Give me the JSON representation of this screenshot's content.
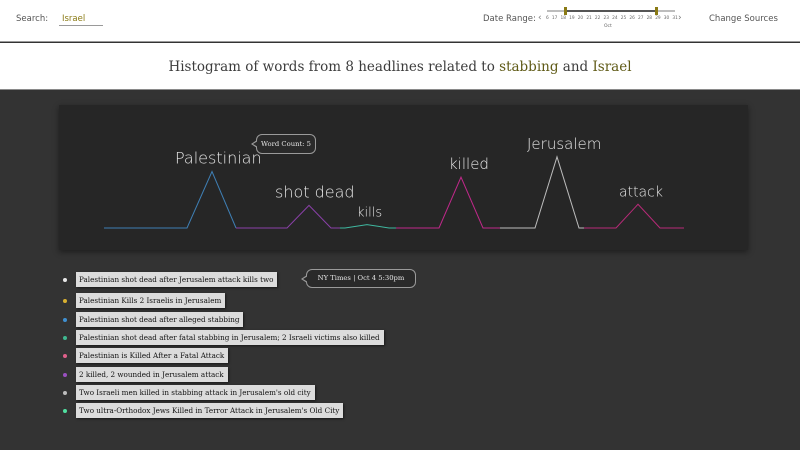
{
  "search": {
    "label": "Search:",
    "value": "Israel"
  },
  "date_range": {
    "label": "Date Range:",
    "prev_arrow": "‹",
    "next_arrow": "›",
    "days": [
      "6",
      "17",
      "18",
      "19",
      "20",
      "21",
      "22",
      "23",
      "24",
      "25",
      "26",
      "27",
      "28",
      "29",
      "30",
      "31"
    ],
    "selected_start": "18",
    "selected_end": "29",
    "month": "Oct"
  },
  "change_sources": "Change Sources",
  "title": {
    "prefix": "Histogram of words from 8 headlines related to",
    "keyword1": "stabbing",
    "conjunction": "and",
    "keyword2": "Israel",
    "keyword_color": "#5f5a16"
  },
  "chart_data": {
    "type": "line",
    "series": [
      {
        "name": "Palestinian",
        "color": "#3f7fb4",
        "peak": 5,
        "word": "Palestinian"
      },
      {
        "name": "shot dead",
        "color": "#8a40a8",
        "peak": 2,
        "word": "shot dead"
      },
      {
        "name": "kills",
        "color": "#3fb8a0",
        "peak": 0.3,
        "word": "kills"
      },
      {
        "name": "killed",
        "color": "#c0288a",
        "peak": 4.5,
        "word": "killed"
      },
      {
        "name": "Jerusalem",
        "color": "#bdbdbd",
        "peak": 6.3,
        "word": "Jerusalem"
      },
      {
        "name": "attack",
        "color": "#b82a78",
        "peak": 2.1,
        "word": "attack"
      }
    ],
    "ylim": [
      0,
      7
    ],
    "tooltip": "Word Count: 5"
  },
  "headlines": [
    {
      "text": "Palestinian shot dead after Jerusalem attack kills two",
      "dot_color": "#e8e8e8"
    },
    {
      "text": "Palestinian Kills 2 Israelis in Jerusalem",
      "dot_color": "#d8b030"
    },
    {
      "text": "Palestinian shot dead after alleged stabbing",
      "dot_color": "#3f8fd0"
    },
    {
      "text": "Palestinian shot dead after fatal stabbing in Jerusalem; 2 Israeli victims also killed",
      "dot_color": "#3fb890"
    },
    {
      "text": "Palestinian is Killed After a Fatal Attack",
      "dot_color": "#e0608a"
    },
    {
      "text": "2 killed, 2 wounded in Jerusalem attack",
      "dot_color": "#9a50c0"
    },
    {
      "text": "Two Israeli men killed in stabbing attack in Jerusalem's old city",
      "dot_color": "#bdbdbd"
    },
    {
      "text": "Two ultra-Orthodox Jews Killed in Terror Attack in Jerusalem's Old City",
      "dot_color": "#50e0a0"
    }
  ],
  "source_tooltip": "NY Times | Oct 4 5:30pm"
}
